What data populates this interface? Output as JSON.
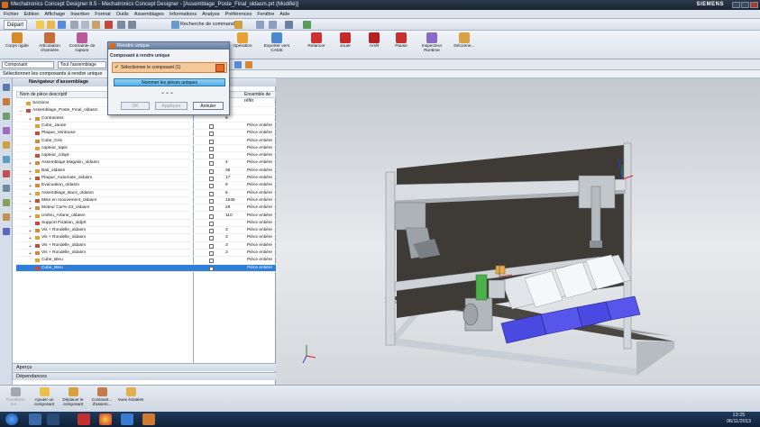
{
  "window": {
    "title": "Mechatronics Concept Designer 8.5 - Mechatronics Concept Designer - [Assemblage_Poste_Final_oldasm.prt (Modifié)]",
    "brand": "SIEMENS"
  },
  "menu": [
    "Fichier",
    "Edition",
    "Affichage",
    "Insertion",
    "Format",
    "Outils",
    "Assemblages",
    "Informations",
    "Analyse",
    "Préférences",
    "Fenêtre",
    "Aide"
  ],
  "quickbar": {
    "start_label": "Départ",
    "command_search": "Recherche de commandes"
  },
  "ribbon": [
    {
      "label": "Corps rigide"
    },
    {
      "label": "Articulation charnière"
    },
    {
      "label": "Contrainte de rupture"
    },
    {
      "label": "Opération"
    },
    {
      "label": "Exporter vers CADE"
    },
    {
      "label": "Relancer"
    },
    {
      "label": "Jouer"
    },
    {
      "label": "Arrêt"
    },
    {
      "label": "Pause"
    },
    {
      "label": "Inspecteur Runtime"
    },
    {
      "label": "Déconne..."
    }
  ],
  "filters": {
    "type_filter": "Composant",
    "scope_filter": "Tout l'assemblage"
  },
  "status_line": "Sélectionner les composants à rendre unique",
  "navigator": {
    "title": "Navigateur d'assemblage",
    "columns": {
      "name": "Nom de pièce descriptif",
      "ref": "Ensemble de référ"
    },
    "rows": [
      {
        "name": "Sections",
        "level": 0,
        "exp": "",
        "val": "",
        "ref": "",
        "cb": false
      },
      {
        "name": "Assemblage_Poste_Final_oldasm",
        "level": 0,
        "exp": "−",
        "val": "",
        "ref": "",
        "cb": false
      },
      {
        "name": "Contraintes",
        "level": 1,
        "exp": "+",
        "val": "6",
        "ref": "",
        "cb": false
      },
      {
        "name": "Cube_Jaune",
        "level": 1,
        "exp": "",
        "val": "",
        "ref": "Pièce entière",
        "cb": true
      },
      {
        "name": "Plaque_Ventouse",
        "level": 1,
        "exp": "",
        "val": "",
        "ref": "Pièce entière",
        "cb": true
      },
      {
        "name": "Cube_Gris",
        "level": 1,
        "exp": "",
        "val": "",
        "ref": "Pièce entière",
        "cb": true
      },
      {
        "name": "capteur_tapis",
        "level": 1,
        "exp": "",
        "val": "",
        "ref": "Pièce entière",
        "cb": true
      },
      {
        "name": "capteur_cdopt",
        "level": 1,
        "exp": "",
        "val": "",
        "ref": "Pièce entière",
        "cb": true
      },
      {
        "name": "Assemblage Magasin_oldasm",
        "level": 1,
        "exp": "+",
        "val": "4",
        "ref": "Pièce entière",
        "cb": true
      },
      {
        "name": "Bati_oldasm",
        "level": 1,
        "exp": "+",
        "val": "36",
        "ref": "Pièce entière",
        "cb": true
      },
      {
        "name": "Plaque_Automate_oldasm",
        "level": 1,
        "exp": "+",
        "val": "17",
        "ref": "Pièce entière",
        "cb": true
      },
      {
        "name": "Evacuation_oldasm",
        "level": 1,
        "exp": "+",
        "val": "9",
        "ref": "Pièce entière",
        "cb": true
      },
      {
        "name": "Assemblage_Bacs_oldasm",
        "level": 1,
        "exp": "+",
        "val": "6",
        "ref": "Pièce entière",
        "cb": true
      },
      {
        "name": "Mise en mouvement_oldasm",
        "level": 1,
        "exp": "+",
        "val": "1536",
        "ref": "Pièce entière",
        "cb": true
      },
      {
        "name": "Moteur Car%-23_oldasm",
        "level": 1,
        "exp": "+",
        "val": "28",
        "ref": "Pièce entière",
        "cb": true
      },
      {
        "name": "Unifeu_Arlane_oldasm",
        "level": 1,
        "exp": "+",
        "val": "110",
        "ref": "Pièce entière",
        "cb": true
      },
      {
        "name": "Support Fixation_oldprt",
        "level": 1,
        "exp": "",
        "val": "",
        "ref": "Pièce entière",
        "cb": true
      },
      {
        "name": "Vis + Rondelle_oldasm",
        "level": 1,
        "exp": "+",
        "val": "3",
        "ref": "Pièce entière",
        "cb": true
      },
      {
        "name": "Vis + Rondelle_oldasm",
        "level": 1,
        "exp": "+",
        "val": "3",
        "ref": "Pièce entière",
        "cb": true
      },
      {
        "name": "Vis + Rondelle_oldasm",
        "level": 1,
        "exp": "+",
        "val": "3",
        "ref": "Pièce entière",
        "cb": true
      },
      {
        "name": "Vis + Rondelle_oldasm",
        "level": 1,
        "exp": "+",
        "val": "3",
        "ref": "Pièce entière",
        "cb": true
      },
      {
        "name": "Cube_Bleu",
        "level": 1,
        "exp": "",
        "val": "",
        "ref": "Pièce entière",
        "cb": true
      },
      {
        "name": "Cube_Bleu",
        "level": 1,
        "exp": "",
        "val": "",
        "ref": "Pièce entière",
        "cb": true,
        "selected": true
      }
    ],
    "apercu": "Aperçu",
    "dependances": "Dépendances"
  },
  "dialog": {
    "title": "Rendre unique",
    "section": "Composant à rendre unique",
    "step": "Sélectionner le composant (1)",
    "name_button": "Nommer les pièces uniques",
    "ok": "OK",
    "apply": "Appliquer",
    "cancel": "Annuler"
  },
  "bottombar": [
    {
      "label": "Transférer les..."
    },
    {
      "label": "Ajouter un composant"
    },
    {
      "label": "Déplacer le composant"
    },
    {
      "label": "Contraint... d'assem..."
    },
    {
      "label": "Vues éclatées"
    }
  ],
  "clock": {
    "time": "13:25",
    "date": "06/11/2013"
  },
  "colors": {
    "accent": "#2f7fd8",
    "dialog_step": "#f6c89a",
    "frame_alu": "#c9ced4",
    "backplate": "#3e3a36",
    "bins": "#4a4ae0"
  }
}
